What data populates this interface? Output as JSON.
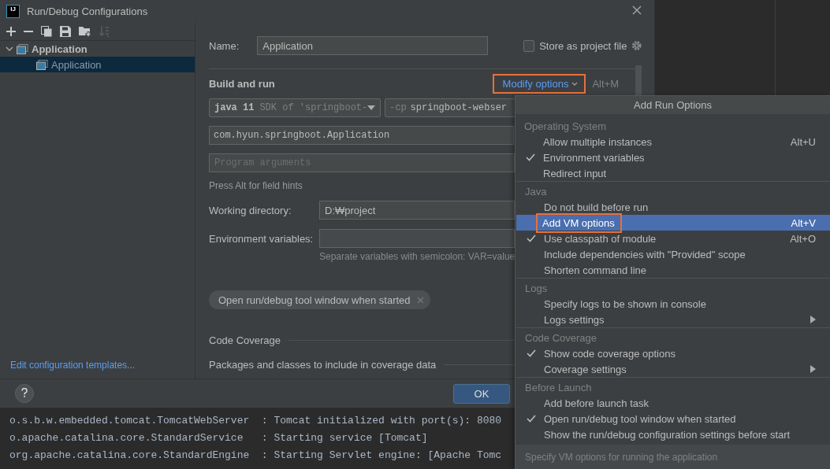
{
  "dialog": {
    "logo_text": "IJ",
    "title": "Run/Debug Configurations",
    "tree": [
      {
        "label": "Application",
        "expanded": true,
        "selected": false,
        "children": [
          {
            "label": "Application",
            "selected": true
          }
        ]
      }
    ],
    "templates_link": "Edit configuration templates...",
    "form": {
      "name_label": "Name:",
      "name_value": "Application",
      "store_label": "Store as project file",
      "store_checked": false,
      "section_title": "Build and run",
      "modify_options": {
        "label": "Modify options",
        "annotated": true
      },
      "modify_shortcut": "Alt+M",
      "jre": {
        "version": "java 11",
        "detail": "SDK of 'springboot-"
      },
      "classpath": {
        "prefix": "-cp",
        "value": "springboot-webser"
      },
      "main_class": "com.hyun.springboot.Application",
      "program_args": {
        "placeholder": "Program arguments"
      },
      "hint": "Press Alt for field hints",
      "working_dir": {
        "label": "Working directory:",
        "value": "D:₩project"
      },
      "env_vars": {
        "label": "Environment variables:",
        "note": "Separate variables with semicolon: VAR=value"
      },
      "chips": [
        {
          "label": "Open run/debug tool window when started"
        }
      ],
      "subsections": [
        "Code Coverage",
        "Packages and classes to include in coverage data"
      ]
    },
    "ok_button": "OK"
  },
  "console": [
    {
      "logger": "o.s.b.w.embedded.tomcat.TomcatWebServer  ",
      "message": ": Tomcat initialized with port(s): 8080"
    },
    {
      "logger": "o.apache.catalina.core.StandardService   ",
      "message": ": Starting service [Tomcat]"
    },
    {
      "logger": "org.apache.catalina.core.StandardEngine  ",
      "message": ": Starting Servlet engine: [Apache Tomc"
    }
  ],
  "popup": {
    "title": "Add Run Options",
    "sections": [
      {
        "title": "Operating System",
        "items": [
          {
            "label": "Allow multiple instances",
            "shortcut": "Alt+U",
            "checked": false,
            "selected": false,
            "annotated": false,
            "submenu": false
          },
          {
            "label": "Environment variables",
            "checked": true,
            "selected": false,
            "annotated": false,
            "submenu": false
          },
          {
            "label": "Redirect input",
            "checked": false,
            "selected": false,
            "annotated": false,
            "submenu": false
          }
        ]
      },
      {
        "title": "Java",
        "items": [
          {
            "label": "Do not build before run",
            "checked": false,
            "selected": false,
            "annotated": false,
            "submenu": false
          },
          {
            "label": "Add VM options",
            "shortcut": "Alt+V",
            "checked": false,
            "selected": true,
            "annotated": true,
            "submenu": false
          },
          {
            "label": "Use classpath of module",
            "shortcut": "Alt+O",
            "checked": true,
            "selected": false,
            "annotated": false,
            "submenu": false
          },
          {
            "label": "Include dependencies with \"Provided\" scope",
            "checked": false,
            "selected": false,
            "annotated": false,
            "submenu": false
          },
          {
            "label": "Shorten command line",
            "checked": false,
            "selected": false,
            "annotated": false,
            "submenu": false
          }
        ]
      },
      {
        "title": "Logs",
        "items": [
          {
            "label": "Specify logs to be shown in console",
            "checked": false,
            "selected": false,
            "annotated": false,
            "submenu": false
          },
          {
            "label": "Logs settings",
            "checked": false,
            "selected": false,
            "annotated": false,
            "submenu": true
          }
        ]
      },
      {
        "title": "Code Coverage",
        "items": [
          {
            "label": "Show code coverage options",
            "checked": true,
            "selected": false,
            "annotated": false,
            "submenu": false
          },
          {
            "label": "Coverage settings",
            "checked": false,
            "selected": false,
            "annotated": false,
            "submenu": true
          }
        ]
      },
      {
        "title": "Before Launch",
        "items": [
          {
            "label": "Add before launch task",
            "checked": false,
            "selected": false,
            "annotated": false,
            "submenu": false
          },
          {
            "label": "Open run/debug tool window when started",
            "checked": true,
            "selected": false,
            "annotated": false,
            "submenu": false
          },
          {
            "label": "Show the run/debug configuration settings before start",
            "checked": false,
            "selected": false,
            "annotated": false,
            "submenu": false
          }
        ]
      }
    ],
    "footer": "Specify VM options for running the application"
  }
}
